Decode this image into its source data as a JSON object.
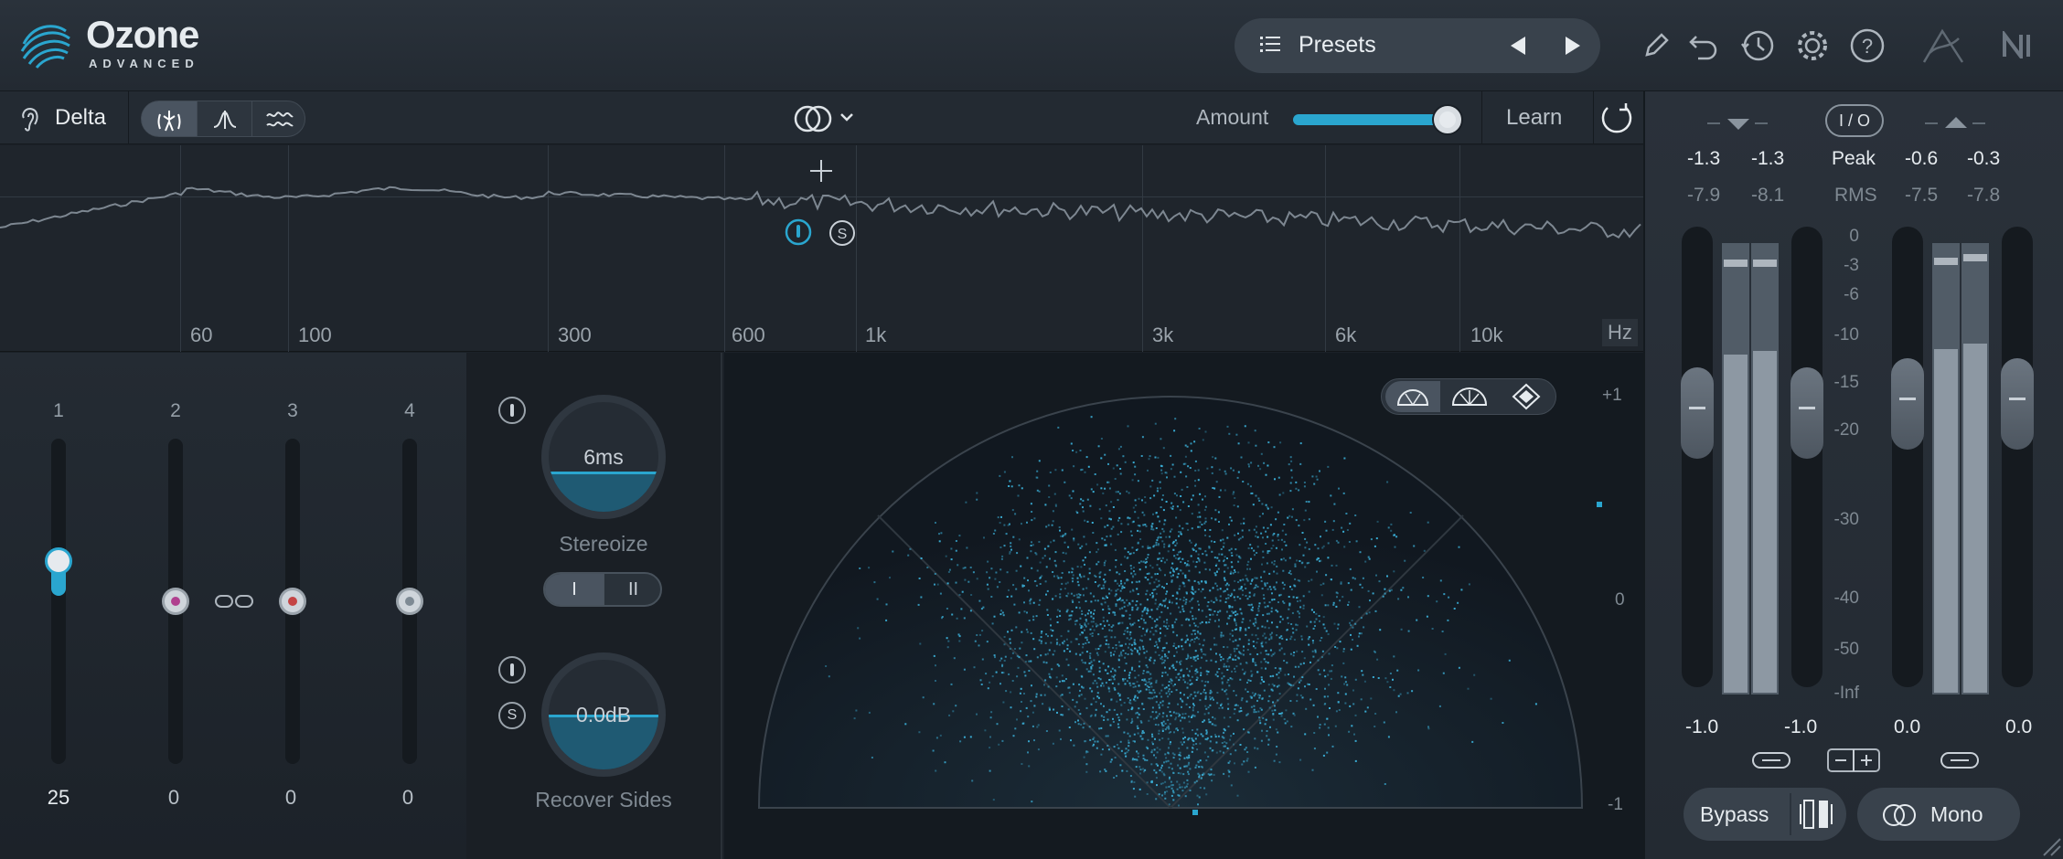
{
  "app": {
    "name": "Ozone",
    "edition": "ADVANCED"
  },
  "header": {
    "presets_label": "Presets",
    "icons": [
      "list-icon",
      "prev-arrow-icon",
      "next-arrow-icon",
      "pencil-icon",
      "undo-icon",
      "history-icon",
      "gear-icon",
      "help-icon",
      "ni-link-icon",
      "ni-logo-icon"
    ]
  },
  "toolbar": {
    "delta_label": "Delta",
    "amount_label": "Amount",
    "amount_value": 1.0,
    "learn_label": "Learn"
  },
  "spectrum": {
    "freq_labels": [
      "60",
      "100",
      "300",
      "600",
      "1k",
      "3k",
      "6k",
      "10k",
      "Hz"
    ]
  },
  "bands": [
    {
      "num": "1",
      "value": "25"
    },
    {
      "num": "2",
      "value": "0"
    },
    {
      "num": "3",
      "value": "0"
    },
    {
      "num": "4",
      "value": "0"
    }
  ],
  "stereoize": {
    "knob_value": "6ms",
    "label": "Stereoize",
    "mode_buttons": [
      "I",
      "II"
    ],
    "recover_value": "0.0dB",
    "recover_label": "Recover Sides"
  },
  "scope": {
    "scale": [
      "+1",
      "0",
      "-1"
    ]
  },
  "meters": {
    "io_label": "I / O",
    "peak_label": "Peak",
    "rms_label": "RMS",
    "in_peak": [
      "-1.3",
      "-1.3"
    ],
    "in_rms": [
      "-7.9",
      "-8.1"
    ],
    "out_peak": [
      "-0.6",
      "-0.3"
    ],
    "out_rms": [
      "-7.5",
      "-7.8"
    ],
    "scale": [
      "0",
      "-3",
      "-6",
      "-10",
      "-15",
      "-20",
      "-30",
      "-40",
      "-50",
      "-Inf"
    ],
    "gain_values": [
      "-1.0",
      "-1.0",
      "0.0",
      "0.0"
    ],
    "bypass_label": "Bypass",
    "mono_label": "Mono"
  },
  "colors": {
    "accent": "#2aa6cf",
    "background": "#1b2128"
  }
}
